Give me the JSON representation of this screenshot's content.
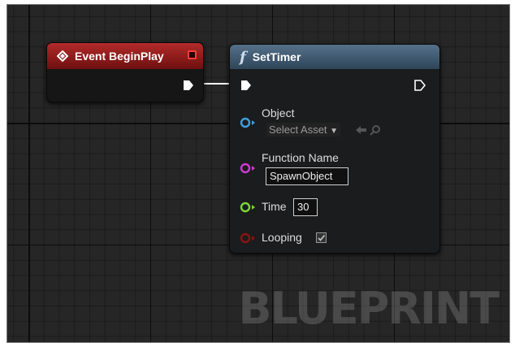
{
  "watermark": "BLUEPRINT",
  "event_node": {
    "title": "Event BeginPlay",
    "icon": "event-diamond-icon",
    "header_color": "#9e2323"
  },
  "function_node": {
    "title": "SetTimer",
    "glyph": "f",
    "header_color": "#4a647d",
    "pins": {
      "object": {
        "label": "Object",
        "asset_placeholder": "Select Asset",
        "color": "#3ea0e0"
      },
      "function_name": {
        "label": "Function Name",
        "value": "SpawnObject",
        "color": "#d23ad2"
      },
      "time": {
        "label": "Time",
        "value": "30",
        "color": "#7fd43a"
      },
      "looping": {
        "label": "Looping",
        "checked": true,
        "color": "#8b1313"
      }
    }
  }
}
